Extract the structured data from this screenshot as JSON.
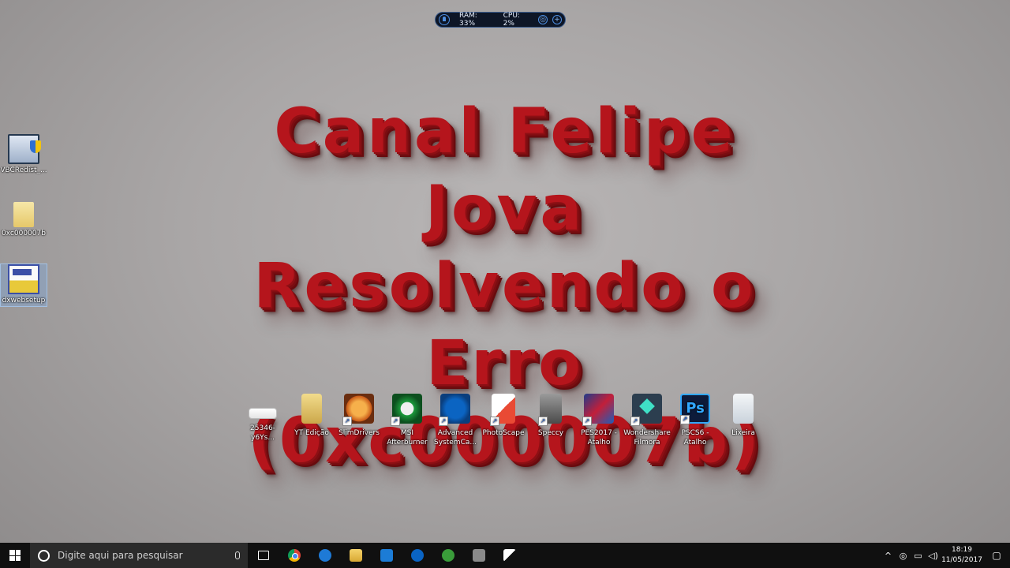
{
  "monitor_widget": {
    "ram": "RAM: 33%",
    "cpu": "CPU: 2%"
  },
  "title": {
    "line1": "Canal Felipe Jova",
    "line2": "Resolvendo o Erro",
    "line3": "(0xc000007b)"
  },
  "desktop_left_icons": [
    {
      "label": "VBCRedist_...",
      "icon": "installer-icon"
    },
    {
      "label": "0xc000007b",
      "icon": "folder-icon"
    },
    {
      "label": "dxwebsetup",
      "icon": "setup-icon"
    }
  ],
  "desktop_row_icons": [
    {
      "label": "25346-y6Ys...",
      "icon": "image-file-icon"
    },
    {
      "label": "YT Edição",
      "icon": "folder-icon"
    },
    {
      "label": "SlimDrivers",
      "icon": "slimdrivers-icon"
    },
    {
      "label": "MSI Afterburner",
      "icon": "msi-afterburner-icon"
    },
    {
      "label": "Advanced SystemCa...",
      "icon": "advanced-systemcare-icon"
    },
    {
      "label": "PhotoScape",
      "icon": "photoscape-icon"
    },
    {
      "label": "Speccy",
      "icon": "speccy-icon"
    },
    {
      "label": "PES2017 - Atalho",
      "icon": "pes2017-icon"
    },
    {
      "label": "Wondershare Filmora",
      "icon": "filmora-icon"
    },
    {
      "label": "PSCS6 - Atalho",
      "icon": "photoshop-icon",
      "text": "Ps"
    },
    {
      "label": "Lixeira",
      "icon": "recycle-bin-icon"
    }
  ],
  "taskbar": {
    "search_placeholder": "Digite aqui para pesquisar",
    "clock_time": "18:19",
    "clock_date": "11/05/2017"
  }
}
